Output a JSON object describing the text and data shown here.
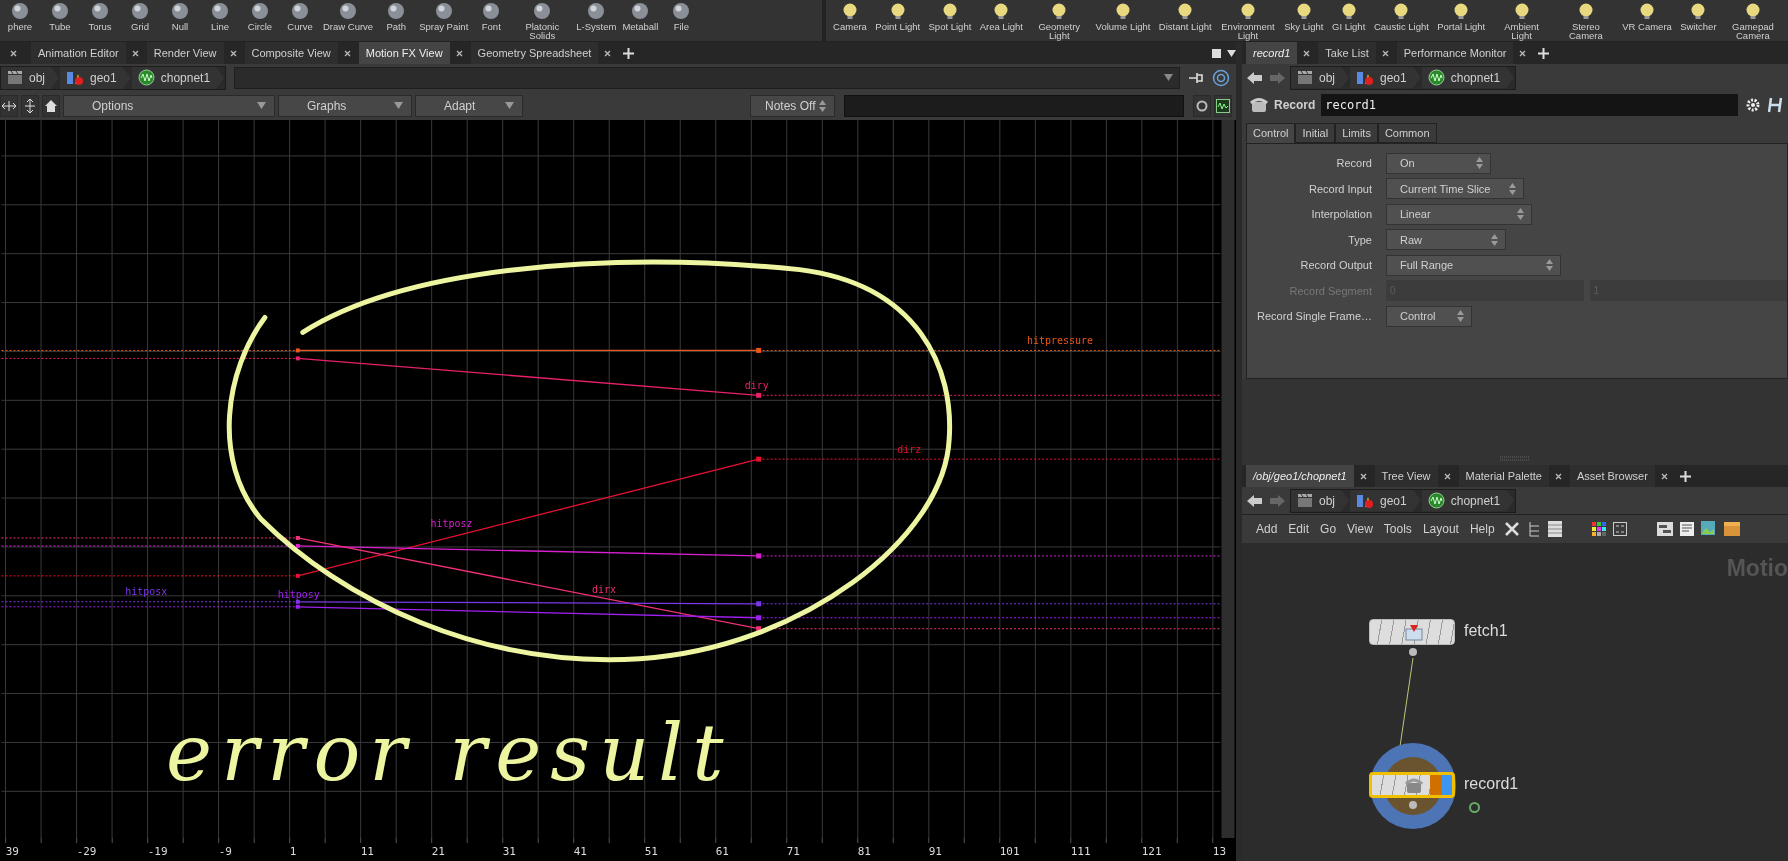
{
  "shelf_left": [
    {
      "label": "phere"
    },
    {
      "label": "Tube"
    },
    {
      "label": "Torus"
    },
    {
      "label": "Grid"
    },
    {
      "label": "Null"
    },
    {
      "label": "Line"
    },
    {
      "label": "Circle"
    },
    {
      "label": "Curve"
    },
    {
      "label": "Draw Curve"
    },
    {
      "label": "Path"
    },
    {
      "label": "Spray Paint"
    },
    {
      "label": "Font"
    },
    {
      "label": "Platonic Solids"
    },
    {
      "label": "L-System"
    },
    {
      "label": "Metaball"
    },
    {
      "label": "File"
    }
  ],
  "shelf_right": [
    {
      "label": "Camera"
    },
    {
      "label": "Point Light"
    },
    {
      "label": "Spot Light"
    },
    {
      "label": "Area Light"
    },
    {
      "label": "Geometry Light"
    },
    {
      "label": "Volume Light"
    },
    {
      "label": "Distant Light"
    },
    {
      "label": "Environment Light"
    },
    {
      "label": "Sky Light"
    },
    {
      "label": "GI Light"
    },
    {
      "label": "Caustic Light"
    },
    {
      "label": "Portal Light"
    },
    {
      "label": "Ambient Light"
    },
    {
      "label": "Stereo Camera"
    },
    {
      "label": "VR Camera"
    },
    {
      "label": "Switcher"
    },
    {
      "label": "Gamepad Camera"
    }
  ],
  "viewer": {
    "tabs": [
      {
        "label": "Animation Editor",
        "selected": false
      },
      {
        "label": "Render View",
        "selected": false
      },
      {
        "label": "Composite View",
        "selected": false
      },
      {
        "label": "Motion FX View",
        "selected": true
      },
      {
        "label": "Geometry Spreadsheet",
        "selected": false
      }
    ],
    "path": [
      {
        "label": "obj"
      },
      {
        "label": "geo1"
      },
      {
        "label": "chopnet1"
      }
    ],
    "menus": [
      {
        "label": "Options"
      },
      {
        "label": "Graphs"
      },
      {
        "label": "Adapt"
      }
    ],
    "notes": "Notes Off",
    "channels": [
      {
        "name": "hitpressure",
        "color": "#e8581a"
      },
      {
        "name": "diry",
        "color": "#e8206a"
      },
      {
        "name": "dirz",
        "color": "#e81030"
      },
      {
        "name": "hitposz",
        "color": "#d820d0"
      },
      {
        "name": "dirx",
        "color": "#f03078"
      },
      {
        "name": "hitposx",
        "color": "#7a38e8"
      },
      {
        "name": "hitposy",
        "color": "#a020f0"
      }
    ],
    "annotation": "error result",
    "frame_ticks": [
      "39",
      "-29",
      "-19",
      "-9",
      "1",
      "11",
      "21",
      "31",
      "41",
      "51",
      "61",
      "71",
      "81",
      "91",
      "101",
      "111",
      "121",
      "13"
    ]
  },
  "parameters": {
    "tabs": [
      {
        "label": "record1",
        "selected": true
      },
      {
        "label": "Take List",
        "selected": false
      },
      {
        "label": "Performance Monitor",
        "selected": false
      }
    ],
    "path": [
      {
        "label": "obj"
      },
      {
        "label": "geo1"
      },
      {
        "label": "chopnet1"
      }
    ],
    "node_type": "Record",
    "node_name": "record1",
    "parm_tabs": [
      {
        "label": "Control",
        "selected": true
      },
      {
        "label": "Initial",
        "selected": false
      },
      {
        "label": "Limits",
        "selected": false
      },
      {
        "label": "Common",
        "selected": false
      }
    ],
    "parms": [
      {
        "label": "Record",
        "kind": "menu",
        "value": "On",
        "disabled": false
      },
      {
        "label": "Record Input",
        "kind": "menu",
        "value": "Current Time Slice",
        "disabled": false
      },
      {
        "label": "Interpolation",
        "kind": "menu",
        "value": "Linear",
        "disabled": false
      },
      {
        "label": "Type",
        "kind": "menu",
        "value": "Raw",
        "disabled": false
      },
      {
        "label": "Record Output",
        "kind": "menu",
        "value": "Full Range",
        "disabled": false
      },
      {
        "label": "Record Segment",
        "kind": "range",
        "values": [
          "0",
          "1"
        ],
        "disabled": true
      },
      {
        "label": "Record Single Frame…",
        "kind": "menu",
        "value": "Control",
        "disabled": false
      }
    ]
  },
  "network": {
    "tabs": [
      {
        "label": "/obj/geo1/chopnet1",
        "selected": true
      },
      {
        "label": "Tree View",
        "selected": false
      },
      {
        "label": "Material Palette",
        "selected": false
      },
      {
        "label": "Asset Browser",
        "selected": false
      }
    ],
    "path": [
      {
        "label": "obj"
      },
      {
        "label": "geo1"
      },
      {
        "label": "chopnet1"
      }
    ],
    "menu": [
      "Add",
      "Edit",
      "Go",
      "View",
      "Tools",
      "Layout",
      "Help"
    ],
    "context_label": "Motio",
    "nodes": [
      {
        "name": "fetch1",
        "selected": false,
        "display": false
      },
      {
        "name": "record1",
        "selected": true,
        "display": true
      }
    ]
  }
}
